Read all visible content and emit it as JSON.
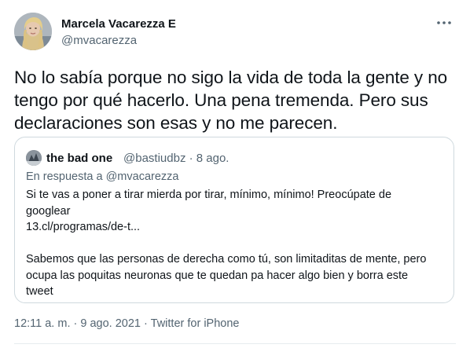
{
  "author": {
    "name": "Marcela Vacarezza E",
    "handle": "@mvacarezza"
  },
  "more_icon": "more-horizontal-icon",
  "tweet_text": "No lo sabía porque no sigo la vida de toda la gente y no tengo por qué hacerlo. Una pena tremenda. Pero sus declaraciones son esas y no me parecen.",
  "quoted": {
    "name": "the bad one",
    "meta": "@bastiudbz · 8 ago.",
    "reply_prefix": "En respuesta a",
    "reply_mention": "@mvacarezza",
    "line1": "Si te vas a poner a tirar mierda por tirar, mínimo, mínimo! Preocúpate de",
    "line2": "googlear",
    "link": "13.cl/programas/de-t...",
    "line4": "Sabemos que las personas de derecha como tú, son limitaditas de mente, pero",
    "line5": "ocupa las poquitas neuronas que te quedan pa hacer algo bien y borra este",
    "line6": "tweet"
  },
  "footer": {
    "time": "12:11 a. m.",
    "date": "9 ago. 2021",
    "source": "Twitter for iPhone",
    "separator": "·"
  },
  "colors": {
    "text": "#0f1419",
    "secondary": "#536471",
    "border": "#cfd9de"
  }
}
